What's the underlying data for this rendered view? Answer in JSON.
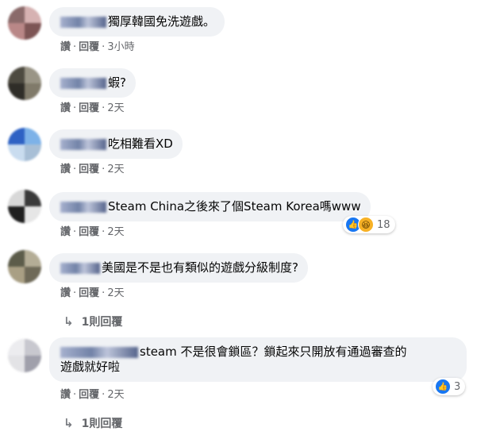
{
  "comments": [
    {
      "text": "獨厚韓國免洗遊戲。",
      "actions": {
        "like": "讚",
        "reply": "回覆",
        "time": "3小時"
      }
    },
    {
      "text": "蝦?",
      "actions": {
        "like": "讚",
        "reply": "回覆",
        "time": "2天"
      }
    },
    {
      "text": "吃相難看XD",
      "actions": {
        "like": "讚",
        "reply": "回覆",
        "time": "2天"
      }
    },
    {
      "text": "Steam China之後來了個Steam Korea嗎www",
      "actions": {
        "like": "讚",
        "reply": "回覆",
        "time": "2天"
      },
      "reactions": {
        "count": "18",
        "icons": [
          "like-icon",
          "haha-icon"
        ]
      }
    },
    {
      "text": "美國是不是也有類似的遊戲分級制度?",
      "actions": {
        "like": "讚",
        "reply": "回覆",
        "time": "2天"
      },
      "replies": {
        "label": "1則回覆"
      }
    },
    {
      "text_line1": "steam 不是很會鎖區？鎖起來只開放有通過審查的",
      "text_line2": "遊戲就好啦",
      "actions": {
        "like": "讚",
        "reply": "回覆",
        "time": "2天"
      },
      "reactions": {
        "count": "3",
        "icons": [
          "like-icon"
        ]
      },
      "replies": {
        "label": "1則回覆"
      }
    }
  ],
  "colors": {
    "bubble": "#f0f2f5",
    "meta": "#65676b",
    "like": "#1877f2",
    "haha": "#f7b125"
  }
}
